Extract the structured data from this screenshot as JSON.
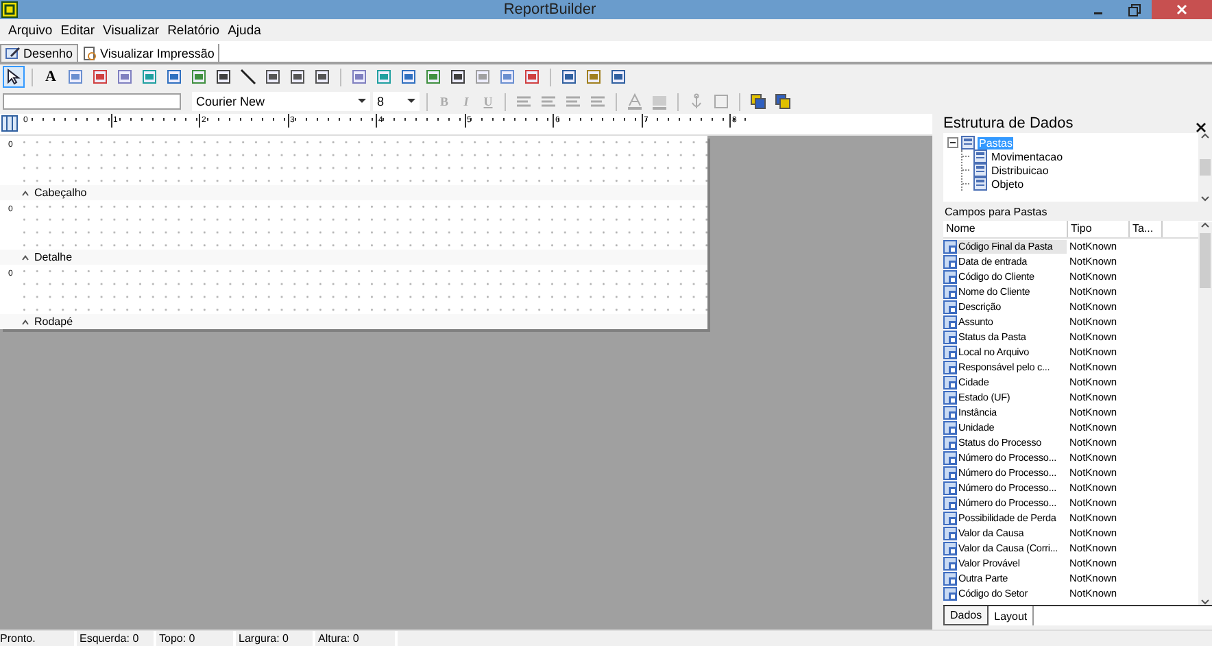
{
  "window": {
    "title": "ReportBuilder"
  },
  "menu": [
    "Arquivo",
    "Editar",
    "Visualizar",
    "Relatório",
    "Ajuda"
  ],
  "tabs": [
    {
      "label": "Desenho",
      "selected": true
    },
    {
      "label": "Visualizar Impressão",
      "selected": false
    }
  ],
  "toolbar": {
    "pointer_selected": true,
    "text_tool": "A"
  },
  "format_bar": {
    "font": "Courier New",
    "size": "8",
    "style_buttons": [
      {
        "label": "B",
        "disabled": true
      },
      {
        "label": "I",
        "disabled": true
      },
      {
        "label": "U",
        "disabled": true
      }
    ]
  },
  "ruler": {
    "labels": [
      "0",
      "1",
      "2",
      "3",
      "4",
      "5",
      "6",
      "7",
      "8"
    ]
  },
  "bands": [
    {
      "ruler_label": "0",
      "title": "Cabeçalho"
    },
    {
      "ruler_label": "0",
      "title": "Detalhe"
    },
    {
      "ruler_label": "0",
      "title": "Rodapé"
    }
  ],
  "data_panel": {
    "title": "Estrutura de Dados",
    "tree": [
      {
        "label": "Pastas",
        "selected": true,
        "expanded": true,
        "children": [
          {
            "label": "Movimentacao",
            "selected": false
          },
          {
            "label": "Distribuicao",
            "selected": false
          },
          {
            "label": "Objeto",
            "selected": false
          }
        ]
      }
    ],
    "fields_caption": "Campos para Pastas",
    "columns": [
      "Nome",
      "Tipo",
      "Ta..."
    ],
    "fields": [
      {
        "name": "Código Final da Pasta",
        "type": "NotKnown",
        "selected": true
      },
      {
        "name": "Data de entrada",
        "type": "NotKnown",
        "selected": false
      },
      {
        "name": "Código do Cliente",
        "type": "NotKnown",
        "selected": false
      },
      {
        "name": "Nome do Cliente",
        "type": "NotKnown",
        "selected": false
      },
      {
        "name": "Descrição",
        "type": "NotKnown",
        "selected": false
      },
      {
        "name": "Assunto",
        "type": "NotKnown",
        "selected": false
      },
      {
        "name": "Status da Pasta",
        "type": "NotKnown",
        "selected": false
      },
      {
        "name": "Local no Arquivo",
        "type": "NotKnown",
        "selected": false
      },
      {
        "name": "Responsável pelo c...",
        "type": "NotKnown",
        "selected": false
      },
      {
        "name": "Cidade",
        "type": "NotKnown",
        "selected": false
      },
      {
        "name": "Estado (UF)",
        "type": "NotKnown",
        "selected": false
      },
      {
        "name": "Instância",
        "type": "NotKnown",
        "selected": false
      },
      {
        "name": "Unidade",
        "type": "NotKnown",
        "selected": false
      },
      {
        "name": "Status do Processo",
        "type": "NotKnown",
        "selected": false
      },
      {
        "name": "Número do Processo...",
        "type": "NotKnown",
        "selected": false
      },
      {
        "name": "Número do Processo...",
        "type": "NotKnown",
        "selected": false
      },
      {
        "name": "Número do Processo...",
        "type": "NotKnown",
        "selected": false
      },
      {
        "name": "Número do Processo...",
        "type": "NotKnown",
        "selected": false
      },
      {
        "name": "Possibilidade de Perda",
        "type": "NotKnown",
        "selected": false
      },
      {
        "name": "Valor da Causa",
        "type": "NotKnown",
        "selected": false
      },
      {
        "name": "Valor da Causa (Corri...",
        "type": "NotKnown",
        "selected": false
      },
      {
        "name": "Valor Provável",
        "type": "NotKnown",
        "selected": false
      },
      {
        "name": "Outra Parte",
        "type": "NotKnown",
        "selected": false
      },
      {
        "name": "Código do Setor",
        "type": "NotKnown",
        "selected": false
      }
    ],
    "bottom_tabs": [
      {
        "label": "Dados",
        "selected": true
      },
      {
        "label": "Layout",
        "selected": false
      }
    ]
  },
  "status_bar": [
    "Pronto.",
    "Esquerda: 0",
    "Topo: 0",
    "Largura: 0",
    "Altura: 0"
  ]
}
